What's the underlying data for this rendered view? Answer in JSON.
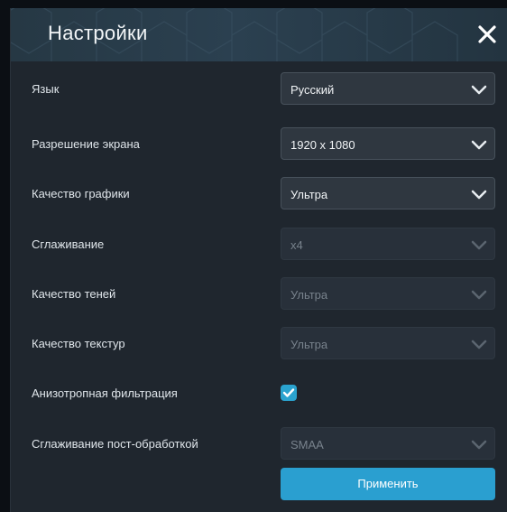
{
  "dialog": {
    "title": "Настройки",
    "apply_label": "Применить"
  },
  "settings": [
    {
      "label": "Язык",
      "value": "Русский",
      "enabled": true
    },
    {
      "label": "Разрешение экрана",
      "value": "1920 x 1080",
      "enabled": true
    },
    {
      "label": "Качество графики",
      "value": "Ультра",
      "enabled": true
    },
    {
      "label": "Сглаживание",
      "value": "x4",
      "enabled": false
    },
    {
      "label": "Качество теней",
      "value": "Ультра",
      "enabled": false
    },
    {
      "label": "Качество текстур",
      "value": "Ультра",
      "enabled": false
    },
    {
      "label": "Анизотропная фильтрация",
      "checked": true
    },
    {
      "label": "Сглаживание пост-обработкой",
      "value": "SMAA",
      "enabled": false
    }
  ],
  "icons": {
    "close": "close-icon",
    "dropdown": "chevron-down-icon",
    "check": "check-icon"
  },
  "colors": {
    "accent": "#2a9fd0",
    "panel": "#1f262e"
  }
}
